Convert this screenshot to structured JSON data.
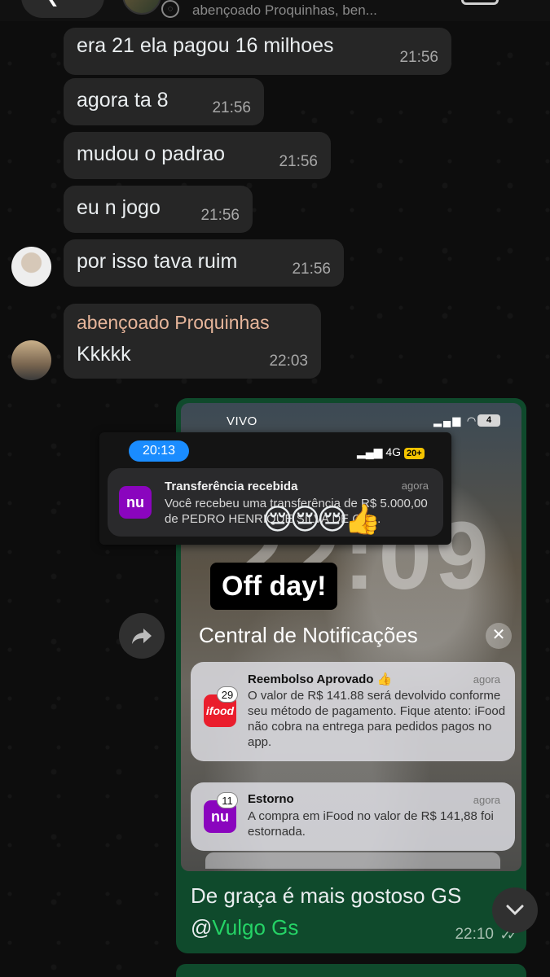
{
  "header": {
    "group_name": "abençoado Proquinhas, ben..."
  },
  "messages": [
    {
      "text": "era 21 ela pagou 16 milhoes",
      "time": "21:56"
    },
    {
      "text": "agora ta 8",
      "time": "21:56"
    },
    {
      "text": "mudou o padrao",
      "time": "21:56"
    },
    {
      "text": "eu n jogo",
      "time": "21:56"
    },
    {
      "text": "por isso tava ruim",
      "time": "21:56"
    },
    {
      "sender": "abençoado Proquinhas",
      "text": "Kkkkk",
      "time": "22:03"
    }
  ],
  "outgoing": {
    "photo": {
      "carrier": "VIVO",
      "battery": "4",
      "clock": "22:09",
      "banner": "Off day!",
      "notification_center_title": "Central de Notificações",
      "close_label": "✕",
      "cards": [
        {
          "app": "iFood",
          "badge": "29",
          "title": "Reembolso Aprovado 👍",
          "time": "agora",
          "body": "O valor de R$ 141.88 será devolvido conforme seu método de pagamento. Fique atento: iFood não cobra na entrega para pedidos pagos no app."
        },
        {
          "app": "nu",
          "badge": "11",
          "title": "Estorno",
          "time": "agora",
          "body": "A compra em iFood no valor de R$ 141,88 foi estornada."
        }
      ]
    },
    "caption_line1": "De graça é mais gostoso GS",
    "caption_at": "@",
    "caption_mention": "Vulgo Gs",
    "time": "22:10",
    "ticks": "✓✓"
  },
  "overlay": {
    "time": "20:13",
    "network": "4G",
    "battery": "20+",
    "app": "nu",
    "title": "Transferência recebida",
    "time_ago": "agora",
    "body": "Você recebeu uma transferência de R$ 5.000,00 de PEDRO HENRIQUE SILVA DE QU...",
    "emojis": "😔😔😔👍"
  },
  "icons": [
    "back-icon",
    "status-ring-icon",
    "video-call-icon",
    "forward-icon",
    "close-icon",
    "chevron-down-icon",
    "read-ticks-icon"
  ],
  "colors": {
    "bubble_in": "#262626",
    "bubble_out": "#0f4a2c",
    "sender_name": "#e6b59a",
    "mention": "#25d366",
    "nubank": "#8a05be",
    "ifood": "#ea1d2c"
  }
}
